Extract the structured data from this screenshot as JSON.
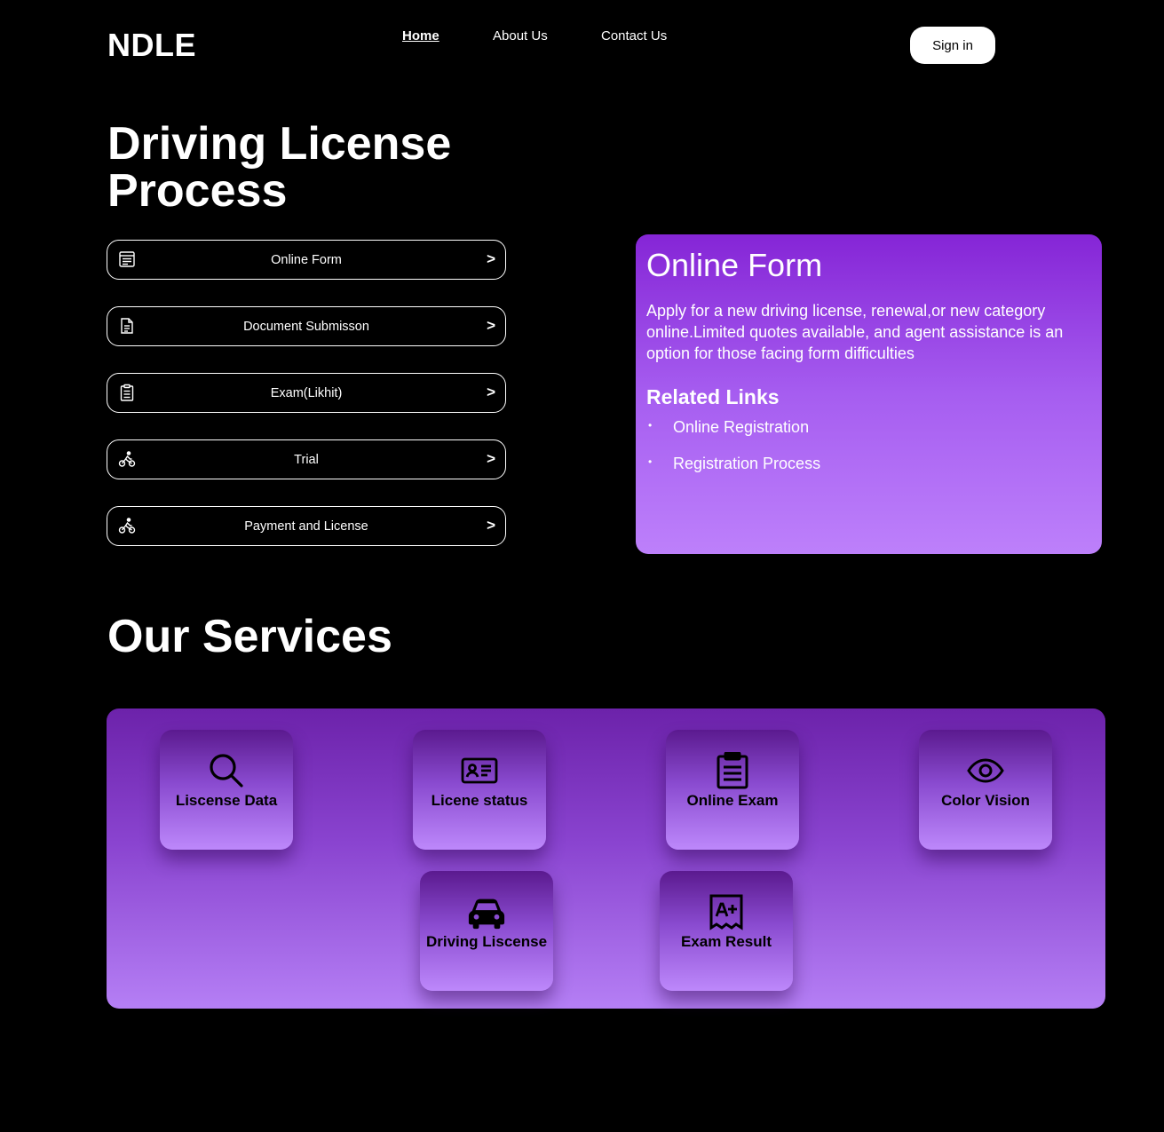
{
  "header": {
    "logo": "NDLE",
    "nav": {
      "home": "Home",
      "about": "About Us",
      "contact": "Contact Us"
    },
    "signin": "Sign in"
  },
  "hero": {
    "title": "Driving License Process",
    "steps": [
      {
        "label": "Online Form",
        "icon": "form-icon",
        "arrow": ">"
      },
      {
        "label": "Document Submisson",
        "icon": "document-icon",
        "arrow": ">"
      },
      {
        "label": "Exam(Likhit)",
        "icon": "clipboard-icon",
        "arrow": ">"
      },
      {
        "label": "Trial",
        "icon": "cyclist-icon",
        "arrow": ">"
      },
      {
        "label": "Payment and License",
        "icon": "cyclist-icon",
        "arrow": ">"
      }
    ]
  },
  "info": {
    "title": "Online Form",
    "description": "Apply for a new driving license, renewal,or new category online.Limited quotes available, and agent assistance is an option for those facing form difficulties",
    "related_title": "Related Links",
    "links": [
      "Online Registration",
      "Registration Process"
    ]
  },
  "services": {
    "title": "Our Services",
    "items": [
      {
        "label": "Liscense Data",
        "icon": "search-icon"
      },
      {
        "label": "Licene status",
        "icon": "id-card-icon"
      },
      {
        "label": "Online Exam",
        "icon": "clipboard-icon"
      },
      {
        "label": "Color Vision",
        "icon": "eye-icon"
      },
      {
        "label": "Driving Liscense",
        "icon": "car-icon"
      },
      {
        "label": "Exam Result",
        "icon": "grade-icon"
      }
    ]
  },
  "colors": {
    "background": "#000000",
    "accent_purple": "#8525d6",
    "accent_light": "#bd80fb"
  }
}
